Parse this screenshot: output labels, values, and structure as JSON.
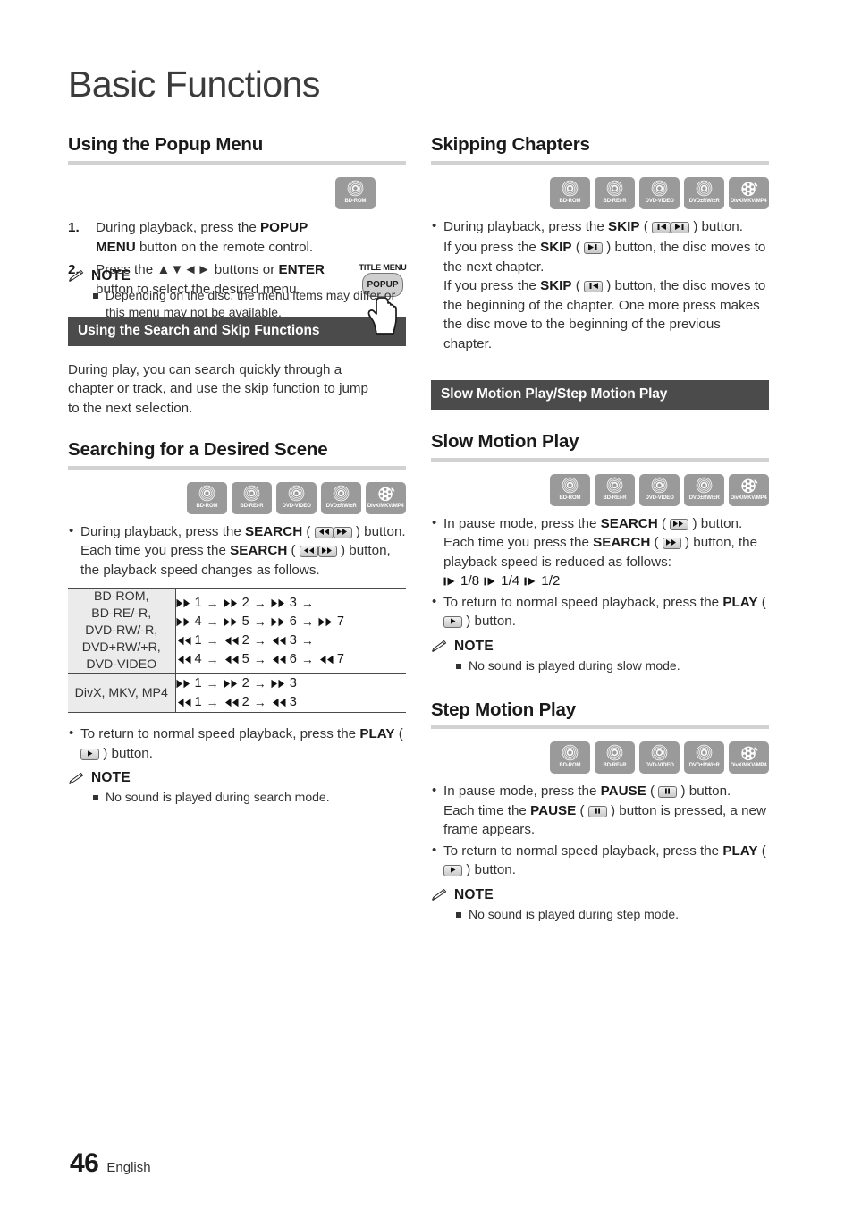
{
  "page": {
    "title": "Basic Functions",
    "footer_page_number": "46",
    "footer_language": "English"
  },
  "colors": {
    "band_background": "#4b4b4b",
    "band_text": "#ffffff",
    "rule": "#d2d2d2",
    "disc_icon_background": "#9a9a9a",
    "table_header_cell": "#ebebeb",
    "table_border": "#4a4a4a",
    "body_text": "#333333"
  },
  "disc_icons": [
    {
      "name": "bd-rom",
      "label": "BD-ROM",
      "glyph": "disc-icon"
    },
    {
      "name": "bd-re-r",
      "label": "BD-RE/-R",
      "glyph": "disc-icon"
    },
    {
      "name": "dvd-video",
      "label": "DVD-VIDEO",
      "glyph": "disc-icon"
    },
    {
      "name": "dvd-rw-r",
      "label": "DVD±RW/±R",
      "glyph": "disc-icon"
    },
    {
      "name": "divx-mkv-mp4",
      "label": "DivX/MKV/MP4",
      "glyph": "film-reel-icon"
    }
  ],
  "left_column": {
    "popup_menu": {
      "heading": "Using the Popup Menu",
      "disc_icons": [
        {
          "name": "bd-rom",
          "label": "BD-ROM",
          "glyph": "disc-icon"
        }
      ],
      "remote_illustration": {
        "top_label": "TITLE MENU",
        "button_label": "POPUP"
      },
      "steps": [
        {
          "number": "1.",
          "parts": [
            {
              "t": "During playback, press the "
            },
            {
              "t": "POPUP MENU",
              "bold": true
            },
            {
              "t": " button on the remote control."
            }
          ]
        },
        {
          "number": "2.",
          "parts": [
            {
              "t": "Press the "
            },
            {
              "t": "▲▼◄►",
              "bold": false
            },
            {
              "t": " buttons or "
            },
            {
              "t": "ENTER",
              "bold": true
            },
            {
              "t": " button to select the desired menu."
            }
          ]
        }
      ],
      "note": {
        "label": "NOTE",
        "items": [
          "Depending on the disc, the menu items may differ or this menu may not be available."
        ]
      }
    },
    "search_skip_band": "Using the Search and Skip Functions",
    "search_skip_intro": "During play, you can search quickly through a chapter or track, and use the skip function to jump to the next selection.",
    "searching_scene": {
      "heading": "Searching for a Desired Scene",
      "bullets": [
        {
          "parts": [
            {
              "t": "During playback, press the "
            },
            {
              "t": "SEARCH",
              "bold": true
            },
            {
              "t": " ( "
            },
            {
              "key": "rewind"
            },
            {
              "key": "fast-forward"
            },
            {
              "t": " ) button."
            }
          ]
        }
      ],
      "sub_text": {
        "parts": [
          {
            "t": "Each time you press the "
          },
          {
            "t": "SEARCH",
            "bold": true
          },
          {
            "t": " ( "
          },
          {
            "key": "rewind"
          },
          {
            "key": "fast-forward"
          },
          {
            "t": " ) button, the playback speed changes as follows."
          }
        ]
      },
      "table": {
        "rows": [
          {
            "disc_types": "BD-ROM,\nBD-RE/-R,\nDVD-RW/-R,\nDVD+RW/+R,\nDVD-VIDEO",
            "sequences": [
              {
                "dir": "ff",
                "steps": [
                  "1",
                  "2",
                  "3"
                ],
                "trailing_arrow": true
              },
              {
                "dir": "ff",
                "steps": [
                  "4",
                  "5",
                  "6",
                  "7"
                ],
                "trailing_arrow": false
              },
              {
                "dir": "rw",
                "steps": [
                  "1",
                  "2",
                  "3"
                ],
                "trailing_arrow": true
              },
              {
                "dir": "rw",
                "steps": [
                  "4",
                  "5",
                  "6",
                  "7"
                ],
                "trailing_arrow": false
              }
            ]
          },
          {
            "disc_types": "DivX, MKV, MP4",
            "sequences": [
              {
                "dir": "ff",
                "steps": [
                  "1",
                  "2",
                  "3"
                ],
                "trailing_arrow": false
              },
              {
                "dir": "rw",
                "steps": [
                  "1",
                  "2",
                  "3"
                ],
                "trailing_arrow": false
              }
            ]
          }
        ]
      },
      "return_bullet": {
        "parts": [
          {
            "t": "To return to normal speed playback, press the "
          },
          {
            "t": "PLAY",
            "bold": true
          },
          {
            "t": " ( "
          },
          {
            "key": "play"
          },
          {
            "t": " ) button."
          }
        ]
      },
      "note": {
        "label": "NOTE",
        "items": [
          "No sound is played during search mode."
        ]
      }
    }
  },
  "right_column": {
    "skipping_chapters": {
      "heading": "Skipping Chapters",
      "bullets": [
        {
          "parts": [
            {
              "t": "During playback, press the "
            },
            {
              "t": "SKIP",
              "bold": true
            },
            {
              "t": " ( "
            },
            {
              "key": "skip-back"
            },
            {
              "key": "skip-forward"
            },
            {
              "t": " ) button."
            }
          ]
        }
      ],
      "paragraphs": [
        {
          "parts": [
            {
              "t": "If you press the "
            },
            {
              "t": "SKIP",
              "bold": true
            },
            {
              "t": " ( "
            },
            {
              "key": "skip-forward"
            },
            {
              "t": " ) button, the disc moves to the next chapter."
            }
          ]
        },
        {
          "parts": [
            {
              "t": "If you press the "
            },
            {
              "t": "SKIP",
              "bold": true
            },
            {
              "t": " ( "
            },
            {
              "key": "skip-back"
            },
            {
              "t": " ) button, the disc moves to the beginning of the chapter. One more press makes the disc move to the beginning of the previous chapter."
            }
          ]
        }
      ]
    },
    "slow_step_band": "Slow Motion Play/Step Motion Play",
    "slow_motion": {
      "heading": "Slow Motion Play",
      "bullets": [
        {
          "parts": [
            {
              "t": "In pause mode, press the "
            },
            {
              "t": "SEARCH",
              "bold": true
            },
            {
              "t": " ( "
            },
            {
              "key": "fast-forward"
            },
            {
              "t": " ) button."
            }
          ]
        }
      ],
      "sub_text": {
        "parts": [
          {
            "t": "Each time you press the "
          },
          {
            "t": "SEARCH",
            "bold": true
          },
          {
            "t": " ( "
          },
          {
            "key": "fast-forward"
          },
          {
            "t": " ) button, the playback speed is reduced as follows:"
          }
        ]
      },
      "speeds": [
        "1/8",
        "1/4",
        "1/2"
      ],
      "return_bullet": {
        "parts": [
          {
            "t": "To return to normal speed playback, press the "
          },
          {
            "t": "PLAY",
            "bold": true
          },
          {
            "t": " ( "
          },
          {
            "key": "play"
          },
          {
            "t": " ) button."
          }
        ]
      },
      "note": {
        "label": "NOTE",
        "items": [
          "No sound is played during slow mode."
        ]
      }
    },
    "step_motion": {
      "heading": "Step Motion Play",
      "bullets": [
        {
          "parts": [
            {
              "t": "In pause mode, press the "
            },
            {
              "t": "PAUSE",
              "bold": true
            },
            {
              "t": " ( "
            },
            {
              "key": "pause"
            },
            {
              "t": " ) button."
            }
          ]
        }
      ],
      "sub_text": {
        "parts": [
          {
            "t": "Each time the "
          },
          {
            "t": "PAUSE",
            "bold": true
          },
          {
            "t": " ( "
          },
          {
            "key": "pause"
          },
          {
            "t": " ) button is pressed, a new frame appears."
          }
        ]
      },
      "return_bullet": {
        "parts": [
          {
            "t": "To return to normal speed playback, press the "
          },
          {
            "t": "PLAY",
            "bold": true
          },
          {
            "t": " ( "
          },
          {
            "key": "play"
          },
          {
            "t": " ) button."
          }
        ]
      },
      "note": {
        "label": "NOTE",
        "items": [
          "No sound is played during step mode."
        ]
      }
    }
  }
}
